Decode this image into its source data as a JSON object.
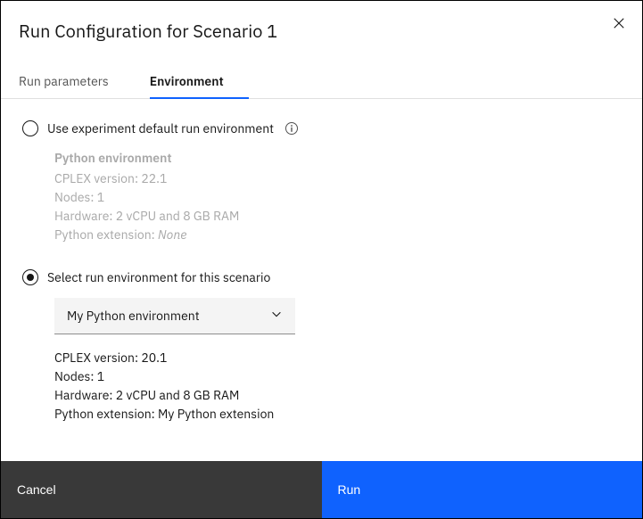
{
  "dialog": {
    "title": "Run Configuration for Scenario 1"
  },
  "tabs": {
    "parameters": "Run parameters",
    "environment": "Environment"
  },
  "option_default": {
    "label": "Use experiment default run environment",
    "subtitle": "Python environment",
    "cplex_label": "CPLEX version: ",
    "cplex_value": "22.1",
    "nodes_label": "Nodes: ",
    "nodes_value": "1",
    "hardware_label": "Hardware: ",
    "hardware_value": "2 vCPU and 8 GB RAM",
    "ext_label": "Python extension: ",
    "ext_value": "None"
  },
  "option_select": {
    "label": "Select run environment for this scenario",
    "dropdown_value": "My Python environment",
    "cplex_label": "CPLEX version: ",
    "cplex_value": "20.1",
    "nodes_label": "Nodes: ",
    "nodes_value": "1",
    "hardware_label": "Hardware: ",
    "hardware_value": "2 vCPU and 8 GB RAM",
    "ext_label": "Python extension: ",
    "ext_value": "My Python extension"
  },
  "footer": {
    "cancel": "Cancel",
    "run": "Run"
  }
}
